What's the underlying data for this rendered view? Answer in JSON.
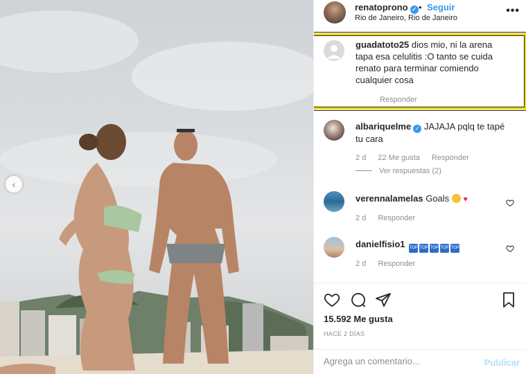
{
  "header": {
    "username": "renatoprono",
    "follow_label": "Seguir",
    "separator": "•",
    "location": "Rio de Janeiro, Rio de Janeiro",
    "more_label": "•••"
  },
  "comments": [
    {
      "username": "guadatoto25",
      "text": "dios mio, ni la arena tapa esa celulitis :O tanto se cuida renato para terminar comiendo cualquier cosa",
      "reply_label": "Responder",
      "highlighted": true,
      "highlight_color": "#f5d800"
    },
    {
      "username": "albariquelme",
      "verified": true,
      "text": "JAJAJA pqlq te tapé tu cara",
      "age": "2 d",
      "likes": "22 Me gusta",
      "reply_label": "Responder",
      "view_replies": "Ver respuestas (2)"
    },
    {
      "username": "verennalamelas",
      "text": "Goals",
      "age": "2 d",
      "reply_label": "Responder"
    },
    {
      "username": "danielfisio1",
      "text": "",
      "emoji_label": "TOP",
      "age": "2 d",
      "reply_label": "Responder"
    }
  ],
  "actions": {
    "likes": "15.592 Me gusta",
    "date": "HACE 2 DÍAS"
  },
  "add_comment": {
    "placeholder": "Agrega un comentario...",
    "publish_label": "Publicar"
  },
  "colors": {
    "link_blue": "#3897f0",
    "publish_disabled": "#b2dffc",
    "highlight": "#f5d800"
  }
}
